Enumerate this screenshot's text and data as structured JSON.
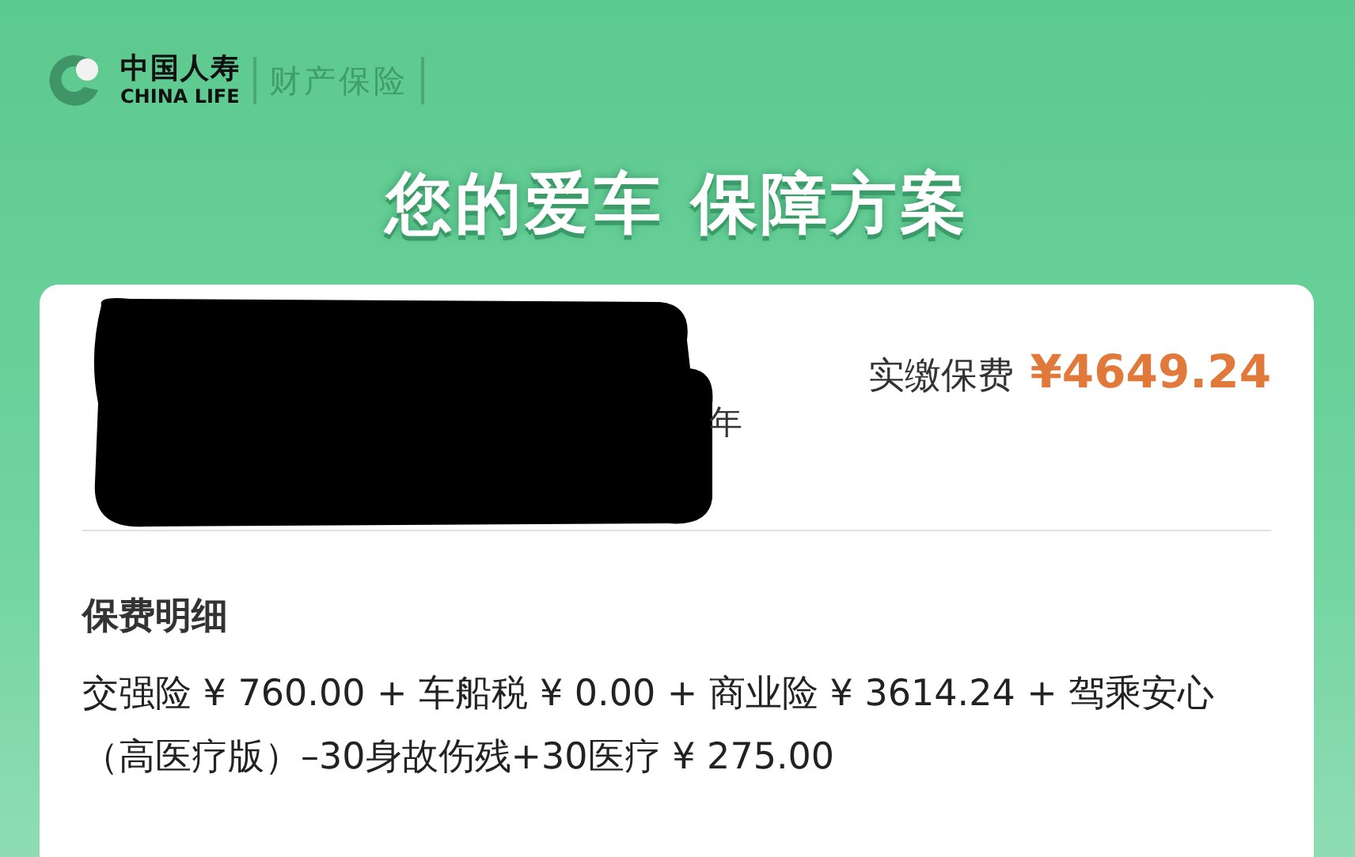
{
  "header": {
    "brand_cn": "中国人寿",
    "brand_en": "CHINA LIFE",
    "division": "财产保险"
  },
  "headline": "您的爱车 保障方案",
  "card": {
    "subtitle_tail": "年",
    "premium_label": "实缴保费",
    "premium_amount": "¥4649.24",
    "details_title": "保费明细",
    "details_text": "交强险 ¥ 760.00 + 车船税 ¥ 0.00 + 商业险 ¥ 3614.24 + 驾乘安心（高医疗版）–30身故伤残+30医疗 ¥ 275.00"
  }
}
